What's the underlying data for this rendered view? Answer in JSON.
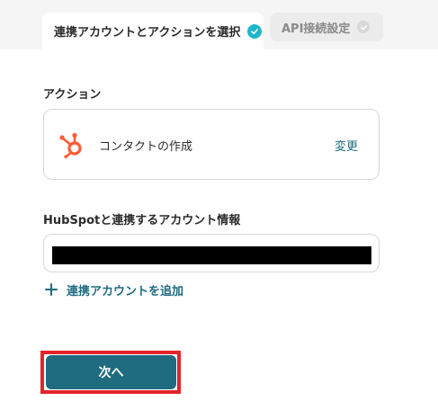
{
  "tabs": [
    {
      "label": "連携アカウントとアクションを選択",
      "state": "active",
      "check_color": "#1fb6c9"
    },
    {
      "label": "API接続設定",
      "state": "inactive",
      "check_color": "#d8d8d8"
    }
  ],
  "action_section": {
    "label": "アクション",
    "card": {
      "icon": "hubspot-icon",
      "icon_color": "#ff5c35",
      "action_name": "コンタクトの作成",
      "change_label": "変更"
    }
  },
  "account_section": {
    "label": "HubSpotと連携するアカウント情報",
    "selected_value_redacted": true,
    "add_account_label": "連携アカウントを追加"
  },
  "footer": {
    "next_button_label": "次へ",
    "button_color": "#1f6b80",
    "highlight_color": "#e3242b"
  }
}
